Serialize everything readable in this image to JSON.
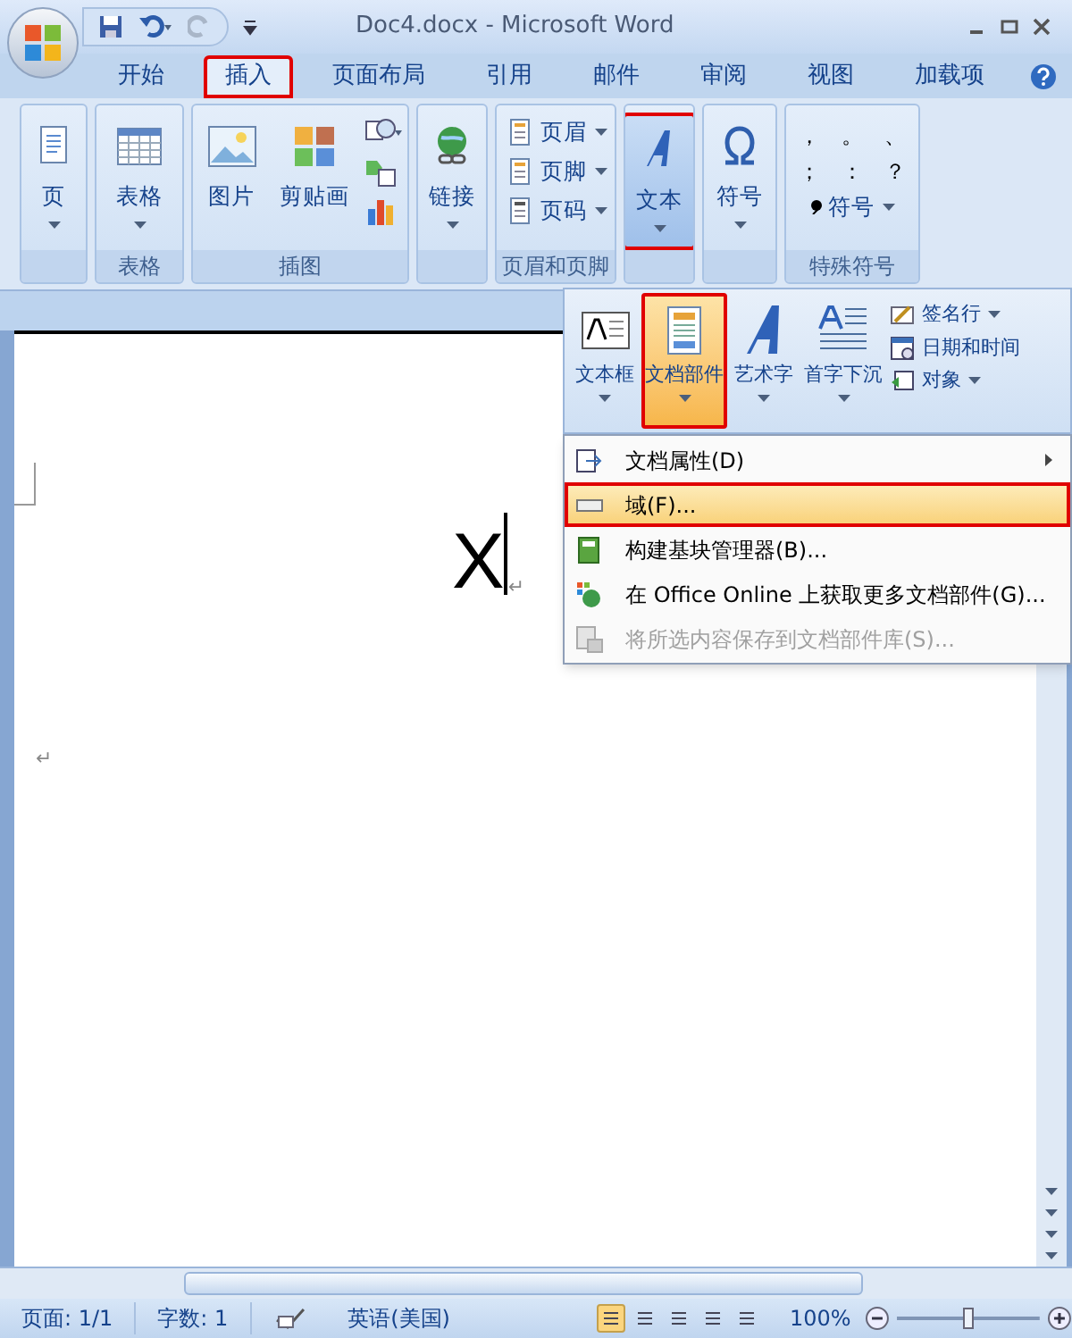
{
  "window": {
    "title": "Doc4.docx - Microsoft Word"
  },
  "tabs": [
    {
      "label": "开始",
      "selected": false,
      "annotated": false
    },
    {
      "label": "插入",
      "selected": true,
      "annotated": true
    },
    {
      "label": "页面布局",
      "selected": false,
      "annotated": false
    },
    {
      "label": "引用",
      "selected": false,
      "annotated": false
    },
    {
      "label": "邮件",
      "selected": false,
      "annotated": false
    },
    {
      "label": "审阅",
      "selected": false,
      "annotated": false
    },
    {
      "label": "视图",
      "selected": false,
      "annotated": false
    },
    {
      "label": "加载项",
      "selected": false,
      "annotated": false
    }
  ],
  "ribbon": {
    "groups": [
      {
        "items": [
          {
            "kind": "large",
            "label": "页",
            "dropdown": true,
            "annotated": false
          }
        ]
      },
      {
        "label": "表格",
        "items": [
          {
            "kind": "large",
            "label": "表格",
            "dropdown": true,
            "annotated": false
          }
        ]
      },
      {
        "label": "插图",
        "items": [
          {
            "kind": "large",
            "label": "图片",
            "dropdown": false,
            "annotated": false
          },
          {
            "kind": "large",
            "label": "剪贴画",
            "dropdown": false,
            "annotated": false
          },
          {
            "kind": "icon_stack"
          }
        ]
      },
      {
        "items": [
          {
            "kind": "large",
            "label": "链接",
            "dropdown": true,
            "annotated": false
          }
        ]
      },
      {
        "label": "页眉和页脚",
        "items": [
          {
            "kind": "small",
            "label": "页眉",
            "dropdown": true
          },
          {
            "kind": "small",
            "label": "页脚",
            "dropdown": true
          },
          {
            "kind": "small",
            "label": "页码",
            "dropdown": true
          }
        ]
      },
      {
        "items": [
          {
            "kind": "large",
            "label": "文本",
            "dropdown": true,
            "annotated": true,
            "open": true
          }
        ]
      },
      {
        "items": [
          {
            "kind": "large",
            "label": "符号",
            "dropdown": true,
            "annotated": false
          }
        ]
      },
      {
        "label": "特殊符号",
        "items": [
          {
            "kind": "symbols",
            "symbols": [
              "，",
              "。",
              "、",
              "；",
              "：",
              "？"
            ],
            "button": "符号",
            "dropdown": true
          }
        ]
      }
    ]
  },
  "text_panel": {
    "large": [
      {
        "label": "文本框",
        "dropdown": true,
        "active": false,
        "annotated": false
      },
      {
        "label": "文档部件",
        "dropdown": true,
        "active": true,
        "annotated": true
      },
      {
        "label": "艺术字",
        "dropdown": true,
        "active": false,
        "annotated": false
      },
      {
        "label": "首字下沉",
        "dropdown": true,
        "active": false,
        "annotated": false
      }
    ],
    "small": [
      {
        "label": "签名行",
        "dropdown": true
      },
      {
        "label": "日期和时间",
        "dropdown": false
      },
      {
        "label": "对象",
        "dropdown": true
      }
    ]
  },
  "parts_menu": {
    "items": [
      {
        "label": "文档属性(D)",
        "submenu": true,
        "selected": false,
        "disabled": false,
        "annotated": false
      },
      {
        "label": "域(F)...",
        "submenu": false,
        "selected": true,
        "disabled": false,
        "annotated": true
      },
      {
        "label": "构建基块管理器(B)...",
        "submenu": false,
        "selected": false,
        "disabled": false,
        "annotated": false
      },
      {
        "label": "在 Office Online 上获取更多文档部件(G)...",
        "submenu": false,
        "selected": false,
        "disabled": false,
        "annotated": false
      },
      {
        "label": "将所选内容保存到文档部件库(S)...",
        "submenu": false,
        "selected": false,
        "disabled": true,
        "annotated": false
      }
    ]
  },
  "document": {
    "line_1": {
      "text": "X",
      "cursor": true,
      "mark": "↵"
    },
    "line_2": {
      "mark": "↵"
    }
  },
  "status_bar": {
    "page": "页面: 1/1",
    "words": "字数: 1",
    "language": "英语(美国)",
    "views": [
      {
        "selected": true
      },
      {
        "selected": false
      },
      {
        "selected": false
      },
      {
        "selected": false
      },
      {
        "selected": false
      }
    ],
    "zoom": "100%",
    "zoom_slider": {
      "level": 0.5
    }
  }
}
